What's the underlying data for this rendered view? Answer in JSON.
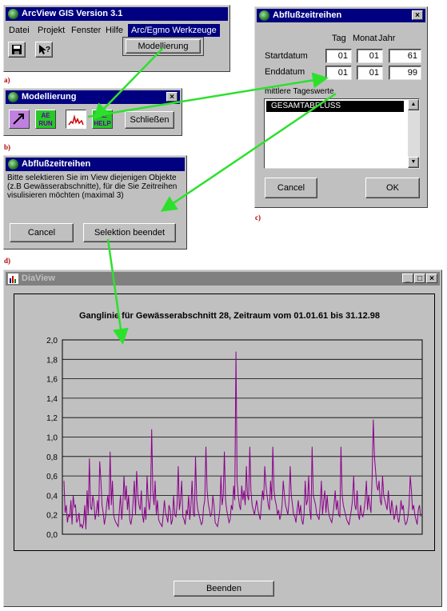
{
  "arcview": {
    "title": "ArcView GIS Version 3.1",
    "menu": [
      "Datei",
      "Projekt",
      "Fenster",
      "Hilfe",
      "Arc/Egmo Werkzeuge"
    ],
    "dropdown_item": "Modellierung"
  },
  "labels": {
    "a": "a)",
    "b": "b)",
    "c": "c)",
    "d": "d)"
  },
  "modellierung": {
    "title": "Modellierung",
    "tools": [
      "AE RUN",
      "AE HELP"
    ],
    "close_label": "Schließen"
  },
  "abfluss_select": {
    "title": "Abflußzeitreihen",
    "message": "Bitte selektieren Sie im View diejenigen Objekte (z.B Gewässerabschnitte), für die Sie Zeitreihen visulisieren möchten (maximal 3)",
    "cancel_label": "Cancel",
    "finish_label": "Selektion beendet"
  },
  "abfluss_date": {
    "title": "Abflußzeitreihen",
    "col_day": "Tag",
    "col_month": "Monat",
    "col_year": "Jahr",
    "start_label": "Startdatum",
    "end_label": "Enddatum",
    "start": [
      "01",
      "01",
      "61"
    ],
    "end": [
      "01",
      "01",
      "99"
    ],
    "list_label": "mittlere Tageswerte",
    "list_items": [
      "GESAMTABFLUSS"
    ],
    "cancel_label": "Cancel",
    "ok_label": "OK"
  },
  "diaview": {
    "title": "DiaView",
    "close_button": "Beenden"
  },
  "chart_data": {
    "type": "line",
    "title": "Ganglinie für Gewässerabschnitt 28, Zeitraum vom 01.01.61 bis 31.12.98",
    "xlabel": "",
    "ylabel": "",
    "ylim": [
      0,
      2.0
    ],
    "yticks": [
      "0,0",
      "0,2",
      "0,4",
      "0,6",
      "0,8",
      "1,0",
      "1,2",
      "1,4",
      "1,6",
      "1,8",
      "2,0"
    ],
    "grid": true,
    "series_color": "#8b008b",
    "series": [
      {
        "values": [
          0.55,
          0.22,
          0.3,
          0.12,
          0.2,
          0.18,
          0.35,
          0.1,
          0.4,
          0.28,
          0.3,
          0.12,
          0.15,
          0.22,
          0.08,
          0.1,
          0.06,
          0.12,
          0.3,
          0.05,
          0.45,
          0.2,
          0.78,
          0.28,
          0.25,
          0.4,
          0.32,
          0.15,
          0.22,
          0.35,
          0.18,
          0.75,
          0.55,
          0.3,
          0.22,
          0.1,
          0.18,
          0.3,
          0.4,
          0.25,
          0.85,
          0.3,
          0.55,
          0.2,
          0.15,
          0.12,
          0.1,
          0.08,
          0.25,
          0.4,
          0.15,
          0.3,
          0.6,
          0.35,
          0.5,
          0.25,
          0.4,
          0.15,
          0.1,
          0.18,
          0.35,
          0.55,
          0.2,
          0.65,
          0.4,
          0.3,
          0.25,
          0.45,
          0.2,
          0.12,
          0.28,
          0.15,
          0.6,
          0.35,
          0.25,
          0.4,
          1.08,
          0.45,
          0.3,
          0.55,
          0.2,
          0.35,
          0.15,
          0.12,
          0.1,
          0.08,
          0.2,
          0.35,
          0.22,
          0.18,
          0.12,
          0.3,
          0.25,
          0.1,
          0.15,
          0.4,
          0.2,
          0.18,
          0.3,
          0.7,
          0.25,
          0.35,
          0.55,
          0.18,
          0.15,
          0.1,
          0.25,
          0.2,
          0.4,
          0.15,
          0.3,
          0.55,
          0.22,
          0.18,
          0.8,
          0.35,
          0.25,
          0.2,
          0.15,
          0.1,
          0.12,
          0.28,
          0.35,
          0.9,
          0.45,
          0.32,
          0.25,
          0.18,
          0.22,
          0.4,
          0.3,
          0.12,
          0.1,
          0.08,
          0.15,
          0.25,
          0.6,
          0.3,
          0.4,
          0.85,
          0.35,
          0.25,
          0.18,
          0.12,
          0.15,
          0.3,
          0.25,
          0.5,
          0.35,
          1.88,
          0.55,
          0.4,
          0.3,
          0.25,
          0.5,
          0.35,
          0.45,
          0.3,
          0.7,
          0.4,
          0.35,
          0.9,
          0.45,
          0.3,
          0.25,
          0.2,
          0.28,
          0.35,
          0.25,
          0.2,
          0.15,
          0.3,
          0.45,
          0.35,
          0.7,
          0.5,
          0.4,
          0.3,
          0.25,
          0.55,
          0.35,
          0.9,
          0.45,
          0.35,
          0.3,
          0.2,
          0.25,
          0.15,
          0.2,
          0.3,
          0.55,
          0.4,
          0.3,
          0.25,
          0.2,
          0.35,
          0.7,
          0.4,
          0.3,
          0.2,
          0.18,
          0.12,
          0.25,
          0.35,
          0.2,
          0.3,
          0.15,
          0.1,
          0.2,
          0.55,
          0.3,
          0.35,
          0.6,
          0.25,
          0.15,
          0.9,
          0.4,
          0.35,
          0.3,
          0.2,
          0.18,
          0.15,
          0.3,
          0.55,
          0.2,
          0.35,
          0.45,
          0.22,
          0.4,
          0.25,
          0.18,
          0.15,
          0.12,
          0.2,
          0.3,
          0.45,
          0.25,
          0.35,
          0.2,
          0.18,
          0.9,
          0.4,
          0.3,
          0.25,
          0.2,
          0.15,
          0.12,
          0.1,
          0.18,
          0.25,
          0.35,
          0.6,
          0.3,
          0.25,
          0.45,
          0.2,
          0.15,
          0.3,
          0.2,
          0.18,
          0.25,
          0.35,
          0.55,
          0.25,
          0.4,
          0.3,
          0.22,
          0.6,
          1.18,
          0.8,
          0.65,
          0.5,
          0.45,
          0.55,
          0.35,
          0.3,
          0.6,
          0.4,
          0.35,
          0.3,
          0.25,
          0.45,
          0.3,
          0.2,
          0.35,
          0.25,
          0.15,
          0.2,
          0.3,
          0.18,
          0.12,
          0.2,
          0.35,
          0.25,
          0.3,
          0.15,
          0.1,
          0.12,
          0.18,
          0.3,
          0.6,
          0.45,
          0.25,
          0.3,
          0.2,
          0.15,
          0.1,
          0.25,
          0.3,
          0.18
        ]
      }
    ]
  }
}
